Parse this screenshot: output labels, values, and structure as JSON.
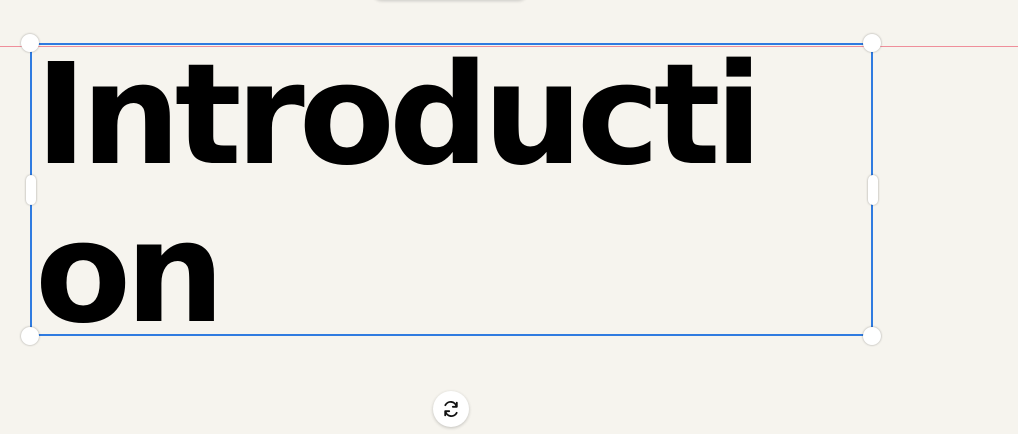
{
  "canvas": {
    "background_color": "#f6f4ee",
    "guide_color": "#ef8e9a"
  },
  "text_box": {
    "text": "Introduction",
    "text_color": "#000000",
    "selection_color": "#2f7be0",
    "selected": true
  },
  "controls": {
    "rotate_icon": "rotate-icon"
  }
}
